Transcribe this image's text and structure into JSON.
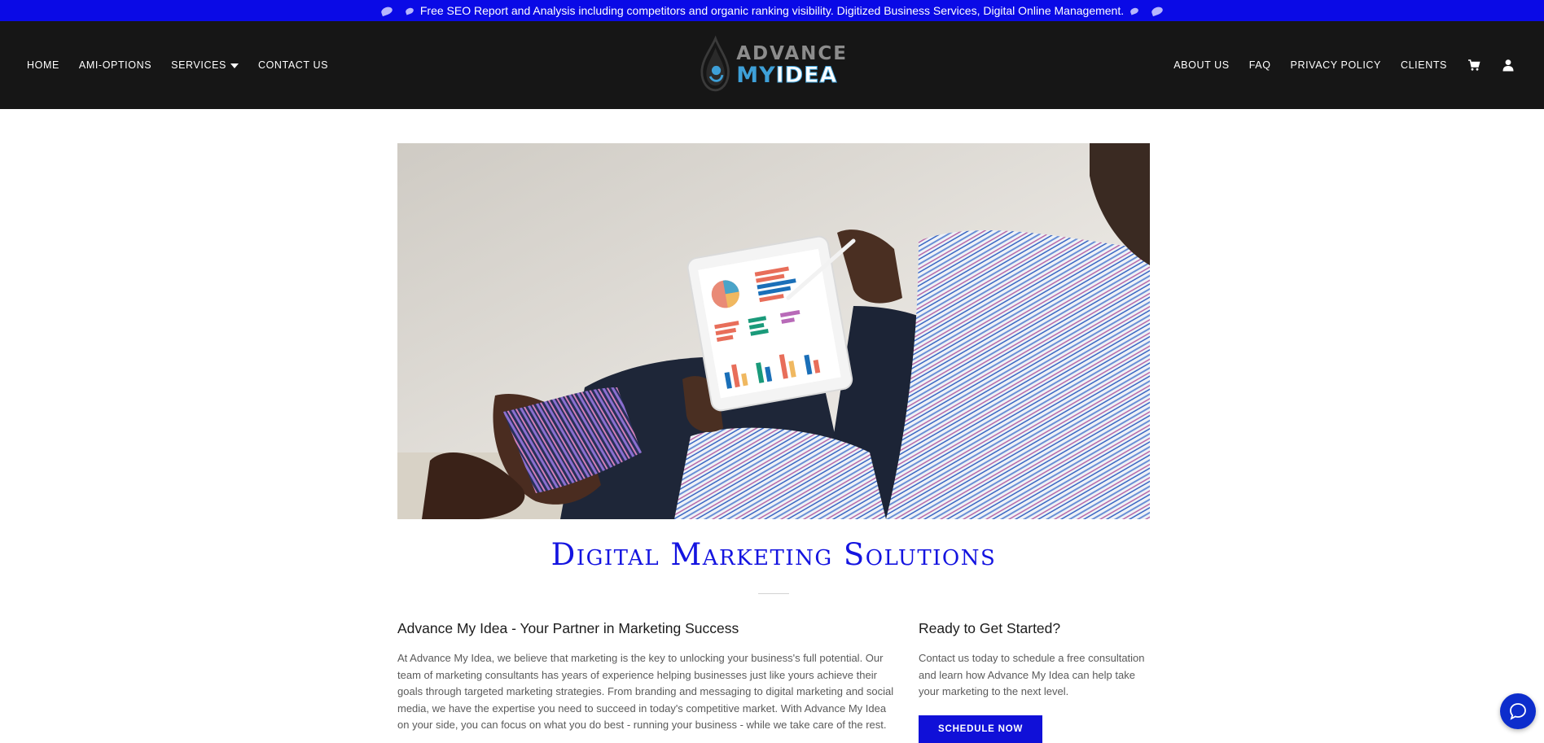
{
  "announcement": {
    "text": "Free SEO Report and Analysis including competitors and organic ranking visibility. Digitized Business Services, Digital Online Management."
  },
  "nav": {
    "left": [
      "HOME",
      "AMI-OPTIONS",
      "SERVICES",
      "CONTACT US"
    ],
    "right": [
      "ABOUT US",
      "FAQ",
      "PRIVACY POLICY",
      "CLIENTS"
    ],
    "icons": [
      "cart-icon",
      "account-icon"
    ]
  },
  "logo": {
    "line1": "ADVANCE",
    "line2_a": "MY",
    "line2_b": "IDEA"
  },
  "hero": {
    "alt": "hero-image"
  },
  "main": {
    "title": "Digital Marketing Solutions",
    "left": {
      "heading": "Advance My Idea - Your Partner in Marketing Success",
      "body": "At Advance My Idea, we believe that marketing is the key to unlocking your business's full potential. Our team of marketing consultants has years of experience helping businesses just like yours achieve their goals through targeted marketing strategies. From branding and messaging to digital marketing and social media, we have the expertise you need to succeed in today's competitive market. With Advance My Idea on your side, you can focus on what you do best - running your business - while we take care of the rest."
    },
    "right": {
      "heading": "Ready to Get Started?",
      "body": "Contact us today to schedule a free consultation and learn how Advance My Idea can help take your marketing to the next level.",
      "button": "SCHEDULE NOW"
    }
  },
  "colors": {
    "announce_bg": "#0a0ae6",
    "nav_bg": "#161616",
    "accent": "#1414e0",
    "logo_blue": "#3ea0d8"
  }
}
